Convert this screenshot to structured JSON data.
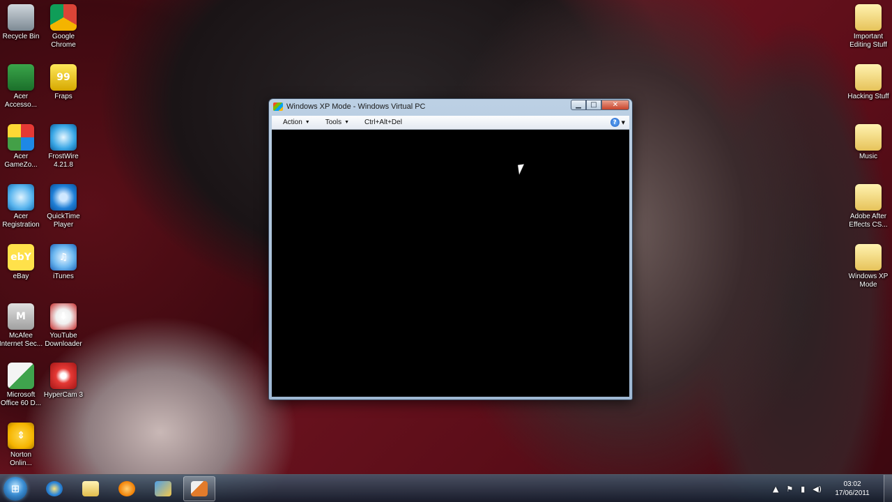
{
  "desktop": {
    "left_icons": [
      {
        "label": "Recycle Bin",
        "icon": "recycle-bin-icon"
      },
      {
        "label": "Google\nChrome",
        "icon": "chrome-icon"
      },
      {
        "label": "Acer\nAccesso...",
        "icon": "acer-icon"
      },
      {
        "label": "Fraps",
        "icon": "fraps-icon",
        "glyph": "99"
      },
      {
        "label": "Acer\nGameZo...",
        "icon": "game-cube-icon"
      },
      {
        "label": "FrostWire\n4.21.8",
        "icon": "frostwire-icon"
      },
      {
        "label": "Acer\nRegistration",
        "icon": "globe-icon"
      },
      {
        "label": "QuickTime\nPlayer",
        "icon": "quicktime-icon"
      },
      {
        "label": "eBay",
        "icon": "ebay-icon",
        "glyph": "ebY"
      },
      {
        "label": "iTunes",
        "icon": "itunes-icon",
        "glyph": "♫"
      },
      {
        "label": "McAfee\nInternet Sec...",
        "icon": "mcafee-icon",
        "glyph": "M"
      },
      {
        "label": "YouTube\nDownloader",
        "icon": "youtube-downloader-icon",
        "glyph": "⬇"
      },
      {
        "label": "Microsoft\nOffice 60 D...",
        "icon": "office-icon"
      },
      {
        "label": "HyperCam 3",
        "icon": "hypercam-icon"
      },
      {
        "label": "Norton\nOnlin...",
        "icon": "norton-icon",
        "glyph": "⇕"
      }
    ],
    "right_icons": [
      {
        "label": "Important\nEditing Stuff",
        "icon": "folder-icon"
      },
      {
        "label": "Hacking Stuff",
        "icon": "folder-icon"
      },
      {
        "label": "Music",
        "icon": "folder-icon"
      },
      {
        "label": "Adobe After\nEffects CS...",
        "icon": "folder-icon"
      },
      {
        "label": "Windows XP\nMode",
        "icon": "folder-icon"
      }
    ]
  },
  "window": {
    "title": "Windows XP Mode - Windows Virtual PC",
    "minimize_glyph": "▁",
    "maximize_glyph": "□",
    "close_glyph": "✕",
    "menu": {
      "action": "Action",
      "tools": "Tools",
      "ctrl_alt_del": "Ctrl+Alt+Del",
      "caret": "▼",
      "help_glyph": "?"
    }
  },
  "taskbar": {
    "start_glyph": "⊞",
    "tray": {
      "up_arrow": "▲",
      "flag": "⚑",
      "network": "▮",
      "volume": "◀)"
    },
    "clock": {
      "time": "03:02",
      "date": "17/06/2011"
    }
  }
}
